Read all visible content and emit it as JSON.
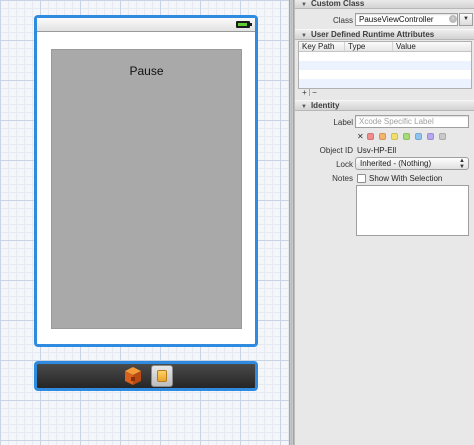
{
  "scene": {
    "label_text": "Pause",
    "colors": {
      "selection_border": "#2f8be0",
      "content_view": "#a9a9a9",
      "dock": "#333333",
      "battery": "#5fcf32"
    },
    "dock_icons": [
      "first-responder-icon",
      "view-controller-icon"
    ]
  },
  "inspector": {
    "custom_class": {
      "title": "Custom Class",
      "class_label": "Class",
      "class_value": "PauseViewController"
    },
    "runtime_attributes": {
      "title": "User Defined Runtime Attributes",
      "columns": [
        "Key Path",
        "Type",
        "Value"
      ],
      "add_symbol": "+",
      "remove_symbol": "−"
    },
    "identity": {
      "title": "Identity",
      "label_label": "Label",
      "label_placeholder": "Xcode Specific Label",
      "clear_symbol": "✕",
      "tag_colors": [
        "#f28b8b",
        "#f5b46a",
        "#f2e06a",
        "#a6dc78",
        "#8cc5f2",
        "#b7a6f0",
        "#c9c9c9"
      ],
      "object_id_label": "Object ID",
      "object_id_value": "Usv-HP-Ell",
      "lock_label": "Lock",
      "lock_value": "Inherited - (Nothing)",
      "notes_label": "Notes",
      "show_with_selection": "Show With Selection"
    }
  }
}
